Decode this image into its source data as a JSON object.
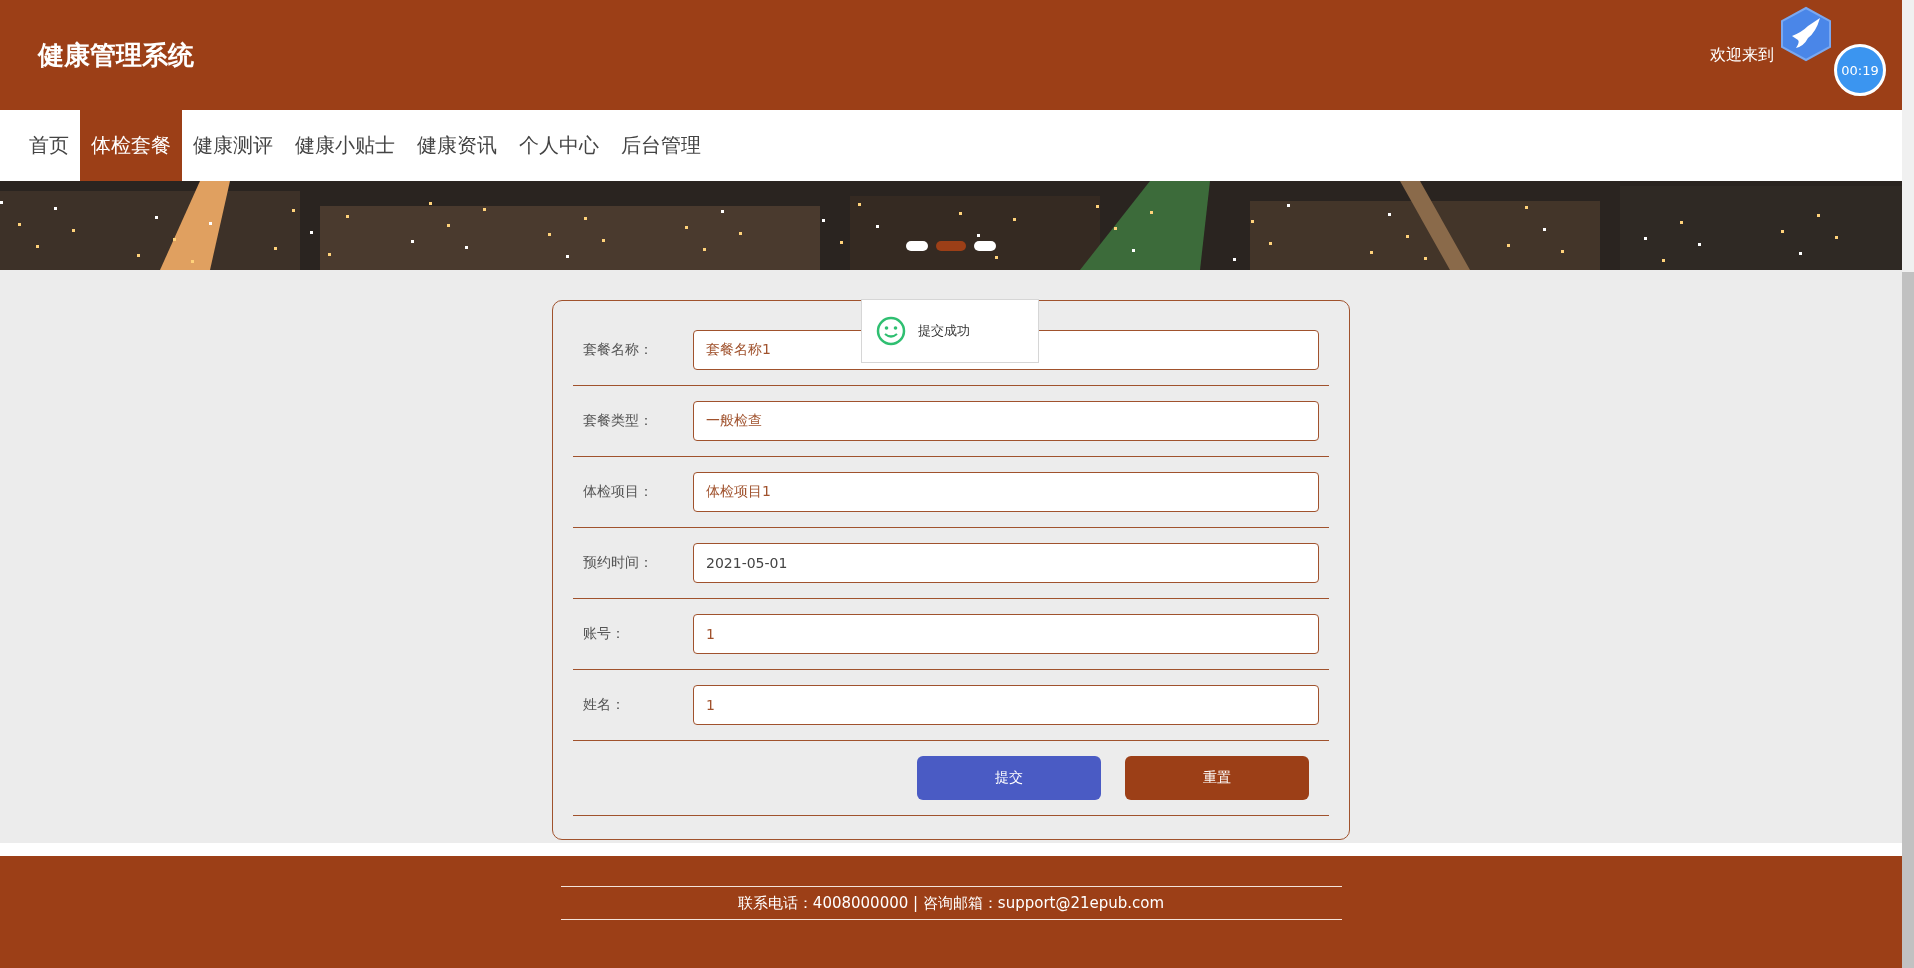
{
  "header": {
    "title": "健康管理系统",
    "welcome": "欢迎来到",
    "timer": "00:19"
  },
  "nav": [
    {
      "label": "首页",
      "selected": false
    },
    {
      "label": "体检套餐",
      "selected": true
    },
    {
      "label": "健康测评",
      "selected": false
    },
    {
      "label": "健康小贴士",
      "selected": false
    },
    {
      "label": "健康资讯",
      "selected": false
    },
    {
      "label": "个人中心",
      "selected": false
    },
    {
      "label": "后台管理",
      "selected": false
    }
  ],
  "banner": {
    "slides": [
      {
        "selected": false
      },
      {
        "selected": true
      },
      {
        "selected": false
      }
    ]
  },
  "form": {
    "fields": [
      {
        "label": "套餐名称：",
        "value": "套餐名称1",
        "kind": "text"
      },
      {
        "label": "套餐类型：",
        "value": "一般检查",
        "kind": "text"
      },
      {
        "label": "体检项目：",
        "value": "体检项目1",
        "kind": "text"
      },
      {
        "label": "预约时间：",
        "value": "2021-05-01",
        "kind": "date"
      },
      {
        "label": "账号：",
        "value": "1",
        "kind": "text"
      },
      {
        "label": "姓名：",
        "value": "1",
        "kind": "text"
      }
    ],
    "buttons": [
      {
        "label": "提交",
        "kind": "primary"
      },
      {
        "label": "重置",
        "kind": "secondary"
      }
    ]
  },
  "toast": {
    "message": "提交成功"
  },
  "footer": {
    "contact": "联系电话：4008000000 | 咨询邮箱：support@21epub.com"
  }
}
